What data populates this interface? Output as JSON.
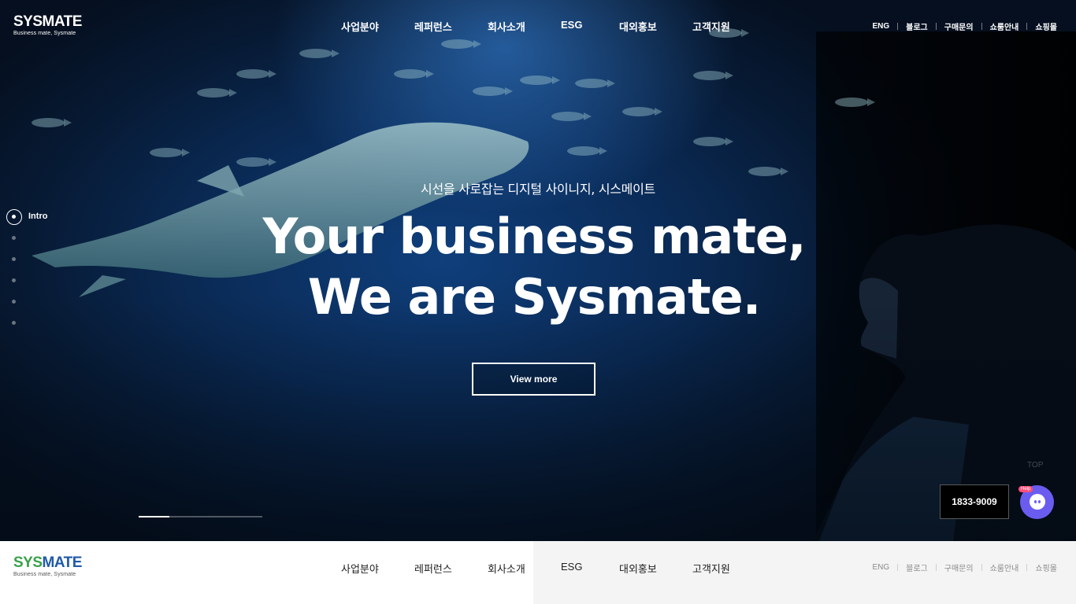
{
  "brand": {
    "logo_word_a": "SYS",
    "logo_word_b": "MATE",
    "tagline": "Business mate, Sysmate"
  },
  "nav": [
    "사업분야",
    "레퍼런스",
    "회사소개",
    "ESG",
    "대외홍보",
    "고객지원"
  ],
  "utility": [
    "ENG",
    "블로그",
    "구매문의",
    "쇼룸안내",
    "쇼핑몰"
  ],
  "hero": {
    "subtitle": "시선을 사로잡는 디지털 사이니지, 시스메이트",
    "title_line1": "Your business mate,",
    "title_line2": "We are Sysmate.",
    "cta_label": "View more"
  },
  "sections": {
    "active_label": "Intro",
    "count": 6
  },
  "slider_progress": 0.25,
  "top_label": "TOP",
  "phone": "1833-9009",
  "help": {
    "badge": "Help",
    "icon": "chatbot-icon"
  },
  "colors": {
    "logo_green": "#3aa14a",
    "logo_blue": "#1f5aa8",
    "help_purple": "#6b5cf0"
  }
}
